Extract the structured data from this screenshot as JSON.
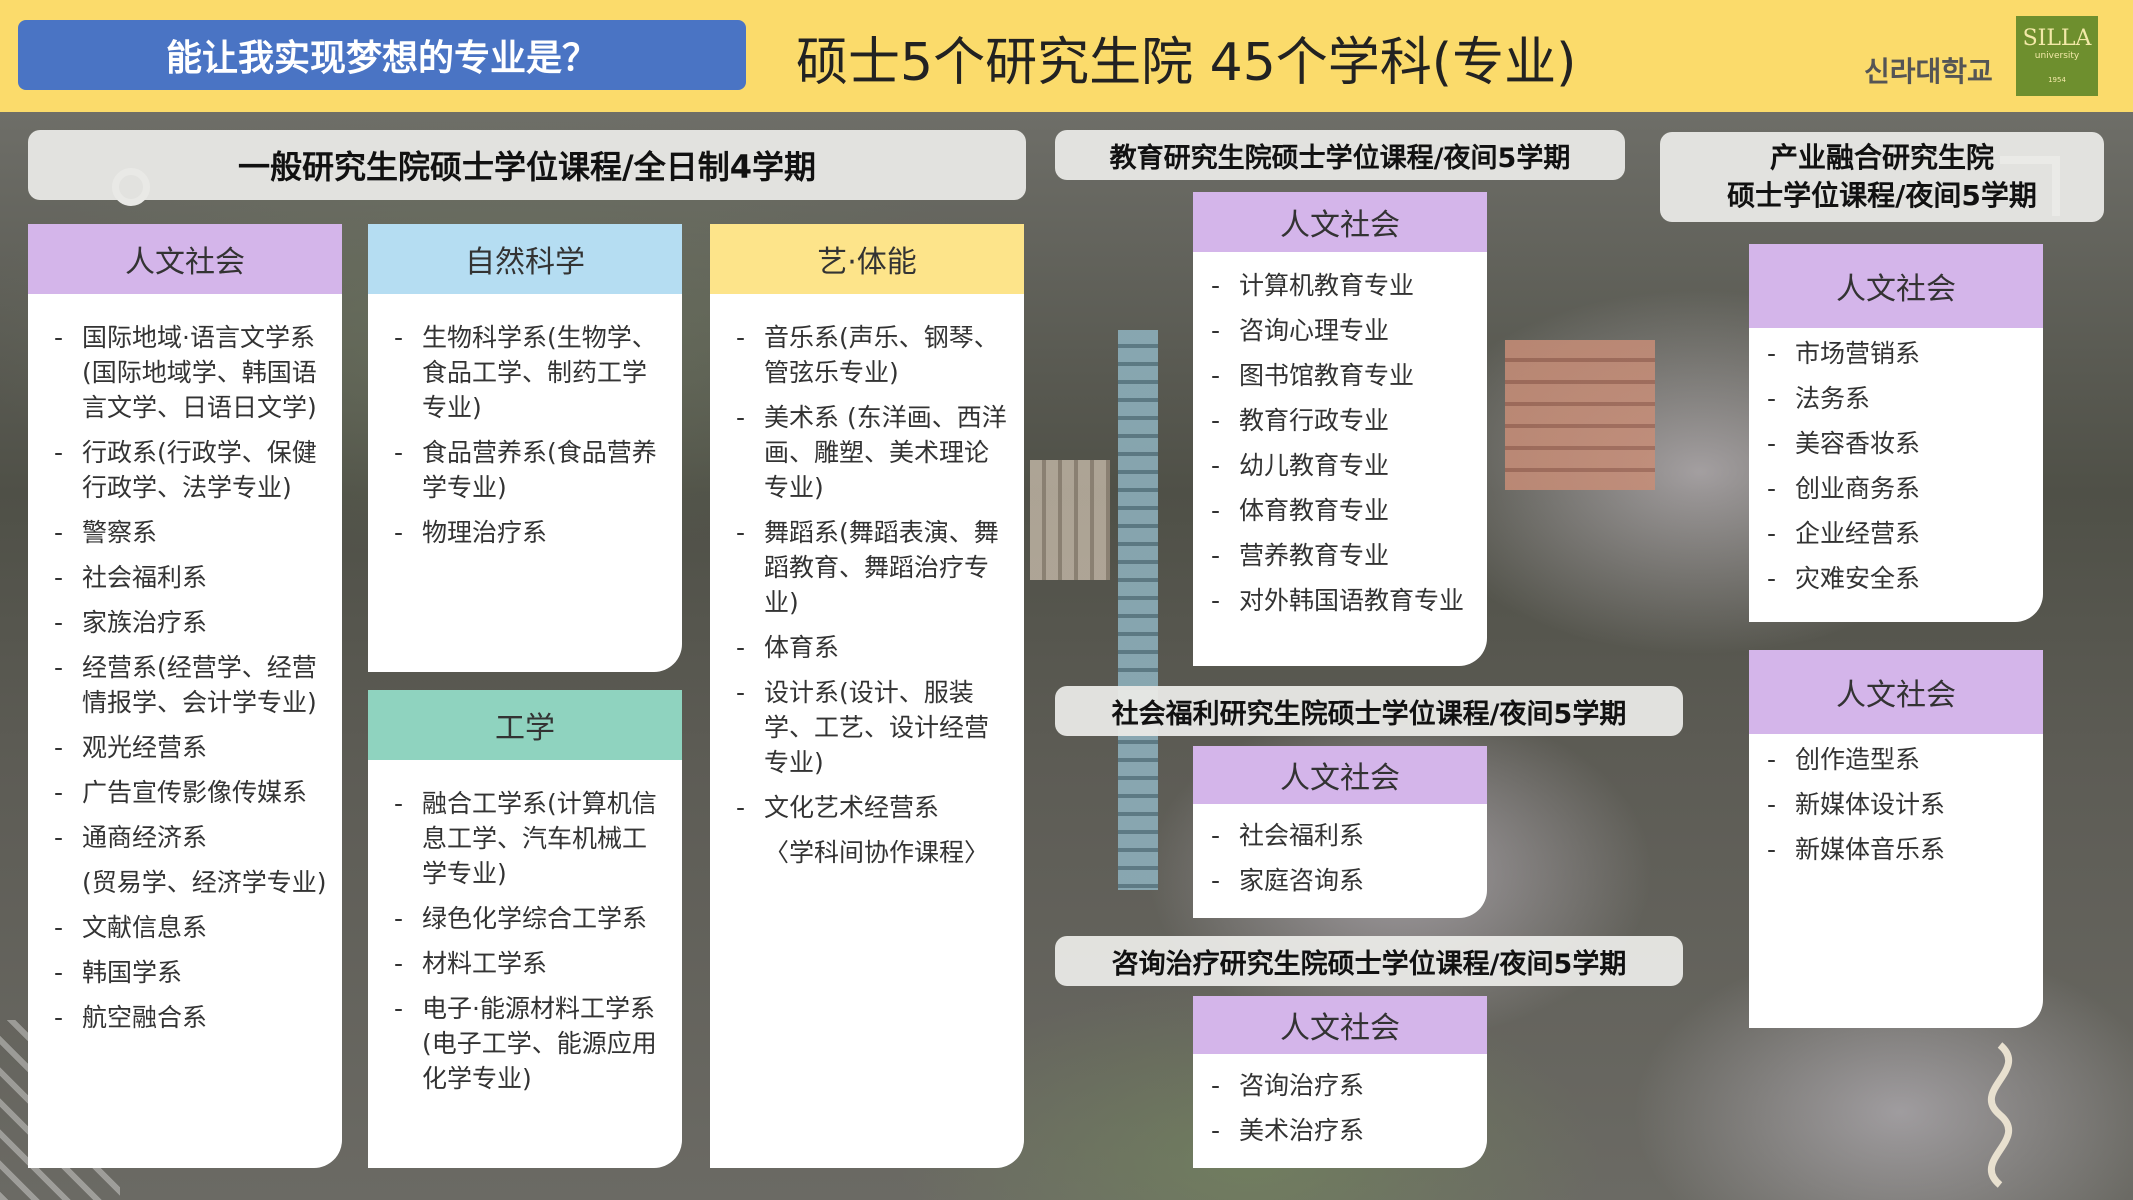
{
  "header": {
    "question": "能让我实现梦想的专业是？",
    "title": "硕士5个研究生院 45个学科(专业)",
    "university_name": "신라대학교",
    "logo_text": "SILLA",
    "logo_sub": "university",
    "logo_year": "1954"
  },
  "general": {
    "header": "一般研究生院硕士学位课程/全日制4学期",
    "humanities": {
      "title": "人文社会",
      "items": [
        "国际地域·语言文学系(国际地域学、韩国语言文学、日语日文学)",
        "行政系(行政学、保健行政学、法学专业)",
        "警察系",
        "社会福利系",
        "家族治疗系",
        "经营系(经营学、经营情报学、会计学专业)",
        "观光经营系",
        "广告宣传影像传媒系",
        "通商经济系",
        "(贸易学、经济学专业)",
        "文献信息系",
        "韩国学系",
        "航空融合系"
      ]
    },
    "science": {
      "title": "自然科学",
      "items": [
        "生物科学系(生物学、食品工学、制药工学专业)",
        "食品营养系(食品营养学专业)",
        "物理治疗系"
      ]
    },
    "engineering": {
      "title": "工学",
      "items": [
        "融合工学系(计算机信息工学、汽车机械工学专业)",
        "绿色化学综合工学系",
        "材料工学系",
        "电子·能源材料工学系(电子工学、能源应用化学专业)"
      ]
    },
    "arts": {
      "title": "艺·体能",
      "items": [
        "音乐系(声乐、钢琴、管弦乐专业)",
        "美术系 (东洋画、西洋画、雕塑、美术理论专业)",
        "舞蹈系(舞蹈表演、舞蹈教育、舞蹈治疗专业)",
        "体育系",
        "设计系(设计、服装学、工艺、设计经营专业)",
        "文化艺术经营系",
        "〈学科间协作课程〉"
      ]
    }
  },
  "education": {
    "header": "教育研究生院硕士学位课程/夜间5学期",
    "card": {
      "title": "人文社会",
      "items": [
        "计算机教育专业",
        "咨询心理专业",
        "图书馆教育专业",
        "教育行政专业",
        "幼儿教育专业",
        "体育教育专业",
        "营养教育专业",
        "对外韩国语教育专业"
      ]
    }
  },
  "welfare": {
    "header": "社会福利研究生院硕士学位课程/夜间5学期",
    "card": {
      "title": "人文社会",
      "items": [
        "社会福利系",
        "家庭咨询系"
      ]
    }
  },
  "counseling": {
    "header": "咨询治疗研究生院硕士学位课程/夜间5学期",
    "card": {
      "title": "人文社会",
      "items": [
        "咨询治疗系",
        "美术治疗系"
      ]
    }
  },
  "industry": {
    "header_line1": "产业融合研究生院",
    "header_line2": "硕士学位课程/夜间5学期",
    "card1": {
      "title": "人文社会",
      "items": [
        "市场营销系",
        "法务系",
        "美容香妆系",
        "创业商务系",
        "企业经营系",
        "灾难安全系"
      ]
    },
    "card2": {
      "title": "人文社会",
      "items": [
        "创作造型系",
        "新媒体设计系",
        "新媒体音乐系"
      ]
    }
  }
}
